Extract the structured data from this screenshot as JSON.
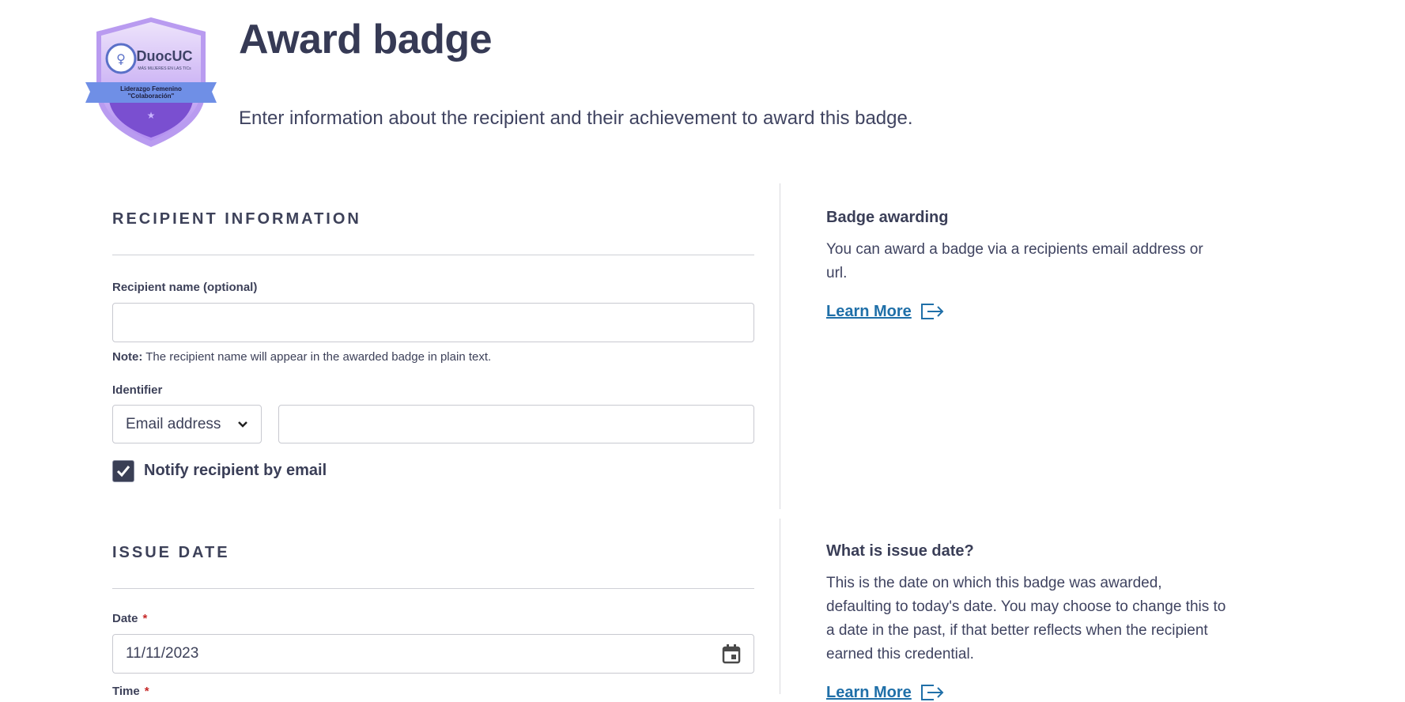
{
  "header": {
    "title": "Award badge",
    "subtitle": "Enter information about the recipient and their achievement to award this badge.",
    "badge": {
      "brand": "DuocUC",
      "tagline": "MÁS MUJERES EN LAS TICs",
      "ribbon_line1": "Liderazgo Femenino",
      "ribbon_line2": "\"Colaboración\""
    }
  },
  "recipient": {
    "section_title": "RECIPIENT INFORMATION",
    "name_label": "Recipient name (optional)",
    "name_value": "",
    "note_label": "Note:",
    "note_text": "The recipient name will appear in the awarded badge in plain text.",
    "identifier_label": "Identifier",
    "identifier_type": "Email address",
    "identifier_value": "",
    "notify_label": "Notify recipient by email",
    "notify_checked": true
  },
  "issue_date": {
    "section_title": "ISSUE DATE",
    "date_label": "Date",
    "date_required": "*",
    "date_value": "11/11/2023",
    "time_label": "Time",
    "time_required": "*"
  },
  "side": {
    "awarding_title": "Badge awarding",
    "awarding_text": "You can award a badge via a recipients email address or url.",
    "learn_more": "Learn More",
    "issue_title": "What is issue date?",
    "issue_text": "This is the date on which this badge was awarded, defaulting to today's date. You may choose to change this to a date in the past, if that better reflects when the recipient earned this credential.",
    "learn_more_2": "Learn More"
  },
  "colors": {
    "text": "#34384f",
    "link": "#1f6fa8",
    "checkbox": "#3a3f55",
    "badge_purple": "#7b5cd6",
    "ribbon_blue": "#6f8fe6"
  }
}
